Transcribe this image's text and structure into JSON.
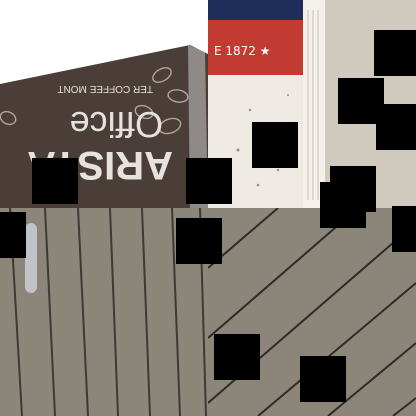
{
  "tiles": [
    {
      "id": "top-left",
      "subject": "dark brown coffee bag with beans pattern"
    },
    {
      "id": "top-right",
      "subject": "red, white and blue coffee can label"
    },
    {
      "id": "bottom-left",
      "subject": "vertical wooden deck boards"
    },
    {
      "id": "bottom-right",
      "subject": "diagonal wooden deck boards"
    }
  ],
  "visible_text": {
    "bag_text_1": "Office",
    "bag_text_2": "ARISTA",
    "bag_text_3": "TER COFFEE MONT",
    "can_text": "E 1872 ★"
  },
  "colors": {
    "bag_brown": "#4b3e38",
    "wood_gray": "#8c857a",
    "can_red": "#c23b32",
    "can_blue": "#1e3a8a"
  }
}
